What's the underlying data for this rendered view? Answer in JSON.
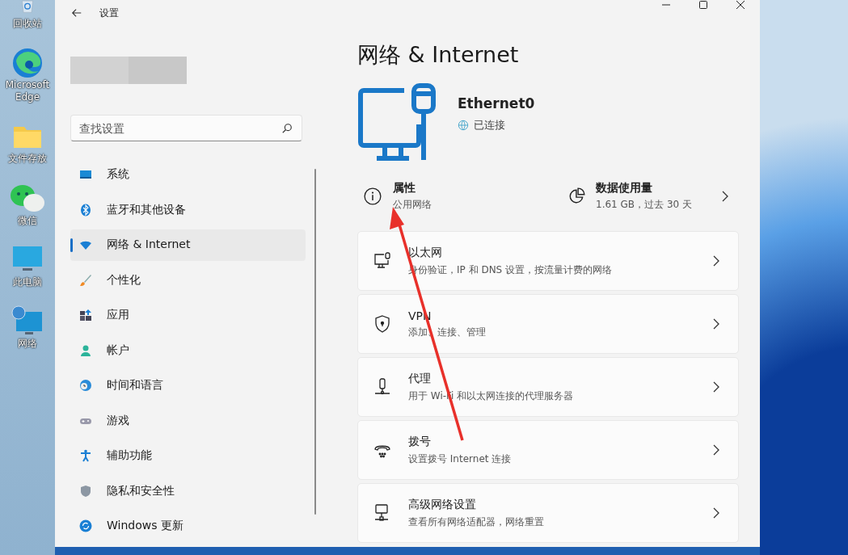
{
  "desktop_icons": [
    {
      "kind": "recycle",
      "label": "回收站"
    },
    {
      "kind": "edge",
      "label": "Microsoft Edge"
    },
    {
      "kind": "folder",
      "label": "文件存放"
    },
    {
      "kind": "chat",
      "label": "微信"
    },
    {
      "kind": "pc",
      "label": "此电脑"
    },
    {
      "kind": "network",
      "label": "网络"
    }
  ],
  "window": {
    "title": "设置"
  },
  "search": {
    "placeholder": "查找设置"
  },
  "sidebar": {
    "items": [
      {
        "kind": "system",
        "label": "系统",
        "selected": false
      },
      {
        "kind": "bluetooth",
        "label": "蓝牙和其他设备",
        "selected": false
      },
      {
        "kind": "wifi",
        "label": "网络 & Internet",
        "selected": true
      },
      {
        "kind": "brush",
        "label": "个性化",
        "selected": false
      },
      {
        "kind": "apps",
        "label": "应用",
        "selected": false
      },
      {
        "kind": "account",
        "label": "帐户",
        "selected": false
      },
      {
        "kind": "time",
        "label": "时间和语言",
        "selected": false
      },
      {
        "kind": "game",
        "label": "游戏",
        "selected": false
      },
      {
        "kind": "access",
        "label": "辅助功能",
        "selected": false
      },
      {
        "kind": "shield",
        "label": "隐私和安全性",
        "selected": false
      },
      {
        "kind": "update",
        "label": "Windows 更新",
        "selected": false
      }
    ]
  },
  "page": {
    "title": "网络 & Internet",
    "connection": {
      "name": "Ethernet0",
      "status": "已连接"
    },
    "properties": {
      "title": "属性",
      "subtitle": "公用网络"
    },
    "data_usage": {
      "title": "数据使用量",
      "subtitle": "1.61 GB，过去 30 天"
    }
  },
  "cards": [
    {
      "kind": "ethernet",
      "title": "以太网",
      "subtitle": "身份验证，IP 和 DNS 设置，按流量计费的网络"
    },
    {
      "kind": "vpn",
      "title": "VPN",
      "subtitle": "添加、连接、管理"
    },
    {
      "kind": "proxy",
      "title": "代理",
      "subtitle": "用于 Wi-Fi 和以太网连接的代理服务器"
    },
    {
      "kind": "dialup",
      "title": "拨号",
      "subtitle": "设置拨号 Internet 连接"
    },
    {
      "kind": "advanced",
      "title": "高级网络设置",
      "subtitle": "查看所有网络适配器，网络重置"
    }
  ]
}
